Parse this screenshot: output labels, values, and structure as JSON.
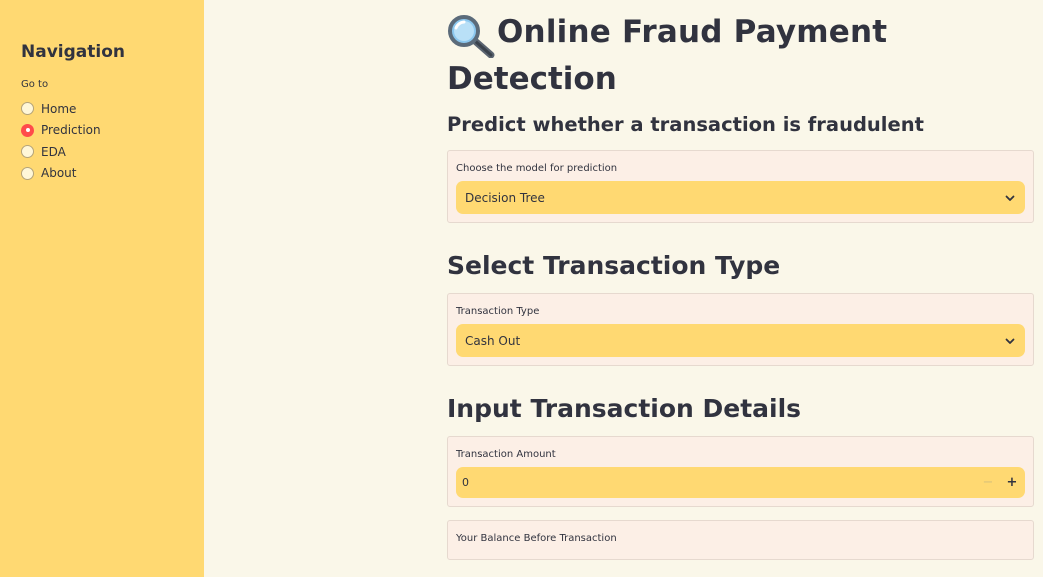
{
  "sidebar": {
    "title": "Navigation",
    "goto_label": "Go to",
    "options": [
      {
        "label": "Home",
        "selected": false
      },
      {
        "label": "Prediction",
        "selected": true
      },
      {
        "label": "EDA",
        "selected": false
      },
      {
        "label": "About",
        "selected": false
      }
    ]
  },
  "main": {
    "title_line1": "Online Fraud Payment",
    "title_line2": "Detection",
    "title_icon": "magnifying-glass-icon",
    "subtitle": "Predict whether a transaction is fraudulent",
    "model_select": {
      "label": "Choose the model for prediction",
      "value": "Decision Tree"
    },
    "section_type": "Select Transaction Type",
    "type_select": {
      "label": "Transaction Type",
      "value": "Cash Out"
    },
    "section_details": "Input Transaction Details",
    "amount_input": {
      "label": "Transaction Amount",
      "value": "0",
      "minus": "−",
      "plus": "+"
    },
    "balance_label": "Your Balance Before Transaction"
  },
  "colors": {
    "sidebar_bg": "#ffd972",
    "main_bg": "#faf7e9",
    "card_bg": "#fcefe6",
    "input_bg": "#ffd972",
    "radio_selected": "#ff4b4b"
  }
}
